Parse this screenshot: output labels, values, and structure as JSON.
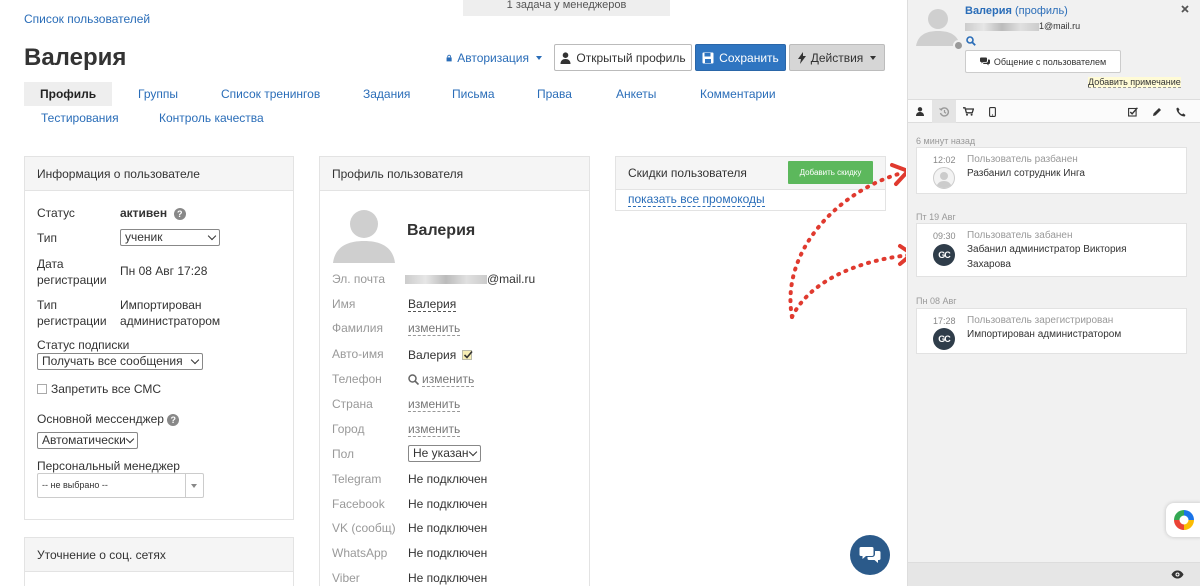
{
  "breadcrumb": "Список пользователей",
  "task_banner": "1 задача у менеджеров",
  "page_title": "Валерия",
  "toolbar": {
    "auth": "Авторизация",
    "open_profile": "Открытый профиль",
    "save": "Сохранить",
    "actions": "Действия"
  },
  "tabs": [
    "Профиль",
    "Группы",
    "Список тренингов",
    "Задания",
    "Письма",
    "Права",
    "Анкеты",
    "Комментарии",
    "Тестирования",
    "Контроль качества"
  ],
  "user_info": {
    "title": "Информация о пользователе",
    "status_label": "Статус",
    "status_value": "активен",
    "type_label": "Тип",
    "type_value": "ученик",
    "reg_date_label1": "Дата",
    "reg_date_label2": "регистрации",
    "reg_date_value": "Пн 08 Авг 17:28",
    "reg_type_label1": "Тип",
    "reg_type_label2": "регистрации",
    "reg_type_value1": "Импортирован",
    "reg_type_value2": "администратором",
    "sub_label": "Статус подписки",
    "sub_value": "Получать все сообщения",
    "sms_label": "Запретить все СМС",
    "messenger_label": "Основной мессенджер",
    "messenger_value": "Автоматически",
    "manager_label": "Персональный менеджер",
    "manager_value": "-- не выбрано --"
  },
  "social_panel_title": "Уточнение о соц. сетях",
  "profile": {
    "title": "Профиль пользователя",
    "name": "Валерия",
    "email_label": "Эл. почта",
    "email_suffix": "@mail.ru",
    "first_name_label": "Имя",
    "first_name_value": "Валерия",
    "last_name_label": "Фамилия",
    "change": "изменить",
    "auto_name_label": "Авто-имя",
    "auto_name_value": "Валерия",
    "phone_label": "Телефон",
    "country_label": "Страна",
    "city_label": "Город",
    "gender_label": "Пол",
    "gender_value": "Не указан",
    "telegram_label": "Telegram",
    "facebook_label": "Facebook",
    "vk_label": "VK (сообщ)",
    "whatsapp_label": "WhatsApp",
    "viber_label": "Viber",
    "not_connected": "Не подключен"
  },
  "discounts": {
    "title": "Скидки пользователя",
    "add_button": "Добавить скидку",
    "show_promos": "показать все промокоды"
  },
  "side": {
    "user_name": "Валерия",
    "profile_link": "(профиль)",
    "email_suffix": "1@mail.ru",
    "chat_button": "Общение с пользователем",
    "add_note": "Добавить примечание",
    "day1": "6 минут назад",
    "ev1_time": "12:02",
    "ev1_type": "Пользователь разбанен",
    "ev1_text": "Разбанил сотрудник Инга",
    "day2": "Пт 19 Авг",
    "ev2_time": "09:30",
    "ev2_type": "Пользователь забанен",
    "ev2_text1": "Забанил администратор Виктория",
    "ev2_text2": "Захарова",
    "day3": "Пн 08 Авг",
    "ev3_time": "17:28",
    "ev3_type": "Пользователь зарегистрирован",
    "ev3_text": "Импортирован администратором",
    "gc_logo": "GC"
  },
  "colors": {
    "link": "#2a6db8",
    "save": "#2f75c1",
    "add_discount": "#5cb85c",
    "annotation_arrow": "#e03a2f"
  }
}
